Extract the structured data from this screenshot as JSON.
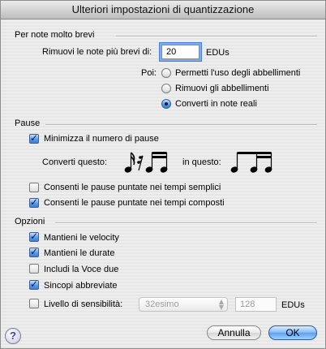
{
  "window": {
    "title": "Ulteriori impostazioni di quantizzazione"
  },
  "sections": {
    "short_notes": "Per note molto brevi",
    "rests": "Pause",
    "options": "Opzioni"
  },
  "short_notes": {
    "remove_label": "Rimuovi le note più brevi di:",
    "remove_value": "20",
    "unit": "EDUs",
    "poi_label": "Poi:",
    "radio_options": [
      "Permetti l'uso degli abbellimenti",
      "Rimuovi gli abbellimenti",
      "Converti in note reali"
    ],
    "selected_index": 2
  },
  "rests": {
    "minimize_label": "Minimizza il numero di pause",
    "minimize_checked": true,
    "convert_label": "Converti questo:",
    "into_label": "in questo:",
    "dotted_simple_label": "Consenti le pause puntate nei tempi semplici",
    "dotted_simple_checked": false,
    "dotted_compound_label": "Consenti le pause puntate nei tempi composti",
    "dotted_compound_checked": true
  },
  "options": {
    "keep_velocity_label": "Mantieni le velocity",
    "keep_velocity_checked": true,
    "keep_durations_label": "Mantieni le durate",
    "keep_durations_checked": true,
    "include_voice2_label": "Includi la Voce due",
    "include_voice2_checked": false,
    "syncopation_label": "Sincopi abbreviate",
    "syncopation_checked": true,
    "sensitivity_label": "Livello di sensibilità:",
    "sensitivity_checked": false,
    "sensitivity_popup_value": "32esimo",
    "sensitivity_field_value": "128",
    "sensitivity_unit": "EDUs"
  },
  "buttons": {
    "cancel": "Annulla",
    "ok": "OK",
    "help": "?"
  },
  "colors": {
    "accent": "#5a9ae6",
    "focus_ring": "#7eaaf0"
  }
}
